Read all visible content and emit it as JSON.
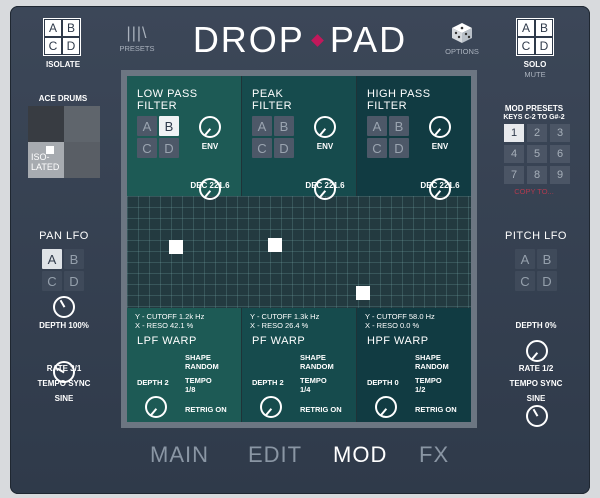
{
  "header": {
    "title_left": "DROP",
    "title_right": "PAD",
    "presets_label": "PRESETS",
    "options_label": "OPTIONS"
  },
  "isolate": {
    "label": "ISOLATE",
    "buttons": [
      "A",
      "B",
      "C",
      "D"
    ]
  },
  "solo": {
    "label": "SOLO",
    "sub": "MUTE",
    "buttons": [
      "A",
      "B",
      "C",
      "D"
    ]
  },
  "kit": {
    "name": "ACE DRUMS",
    "iso_label": "ISO-\nLATED"
  },
  "pan_lfo": {
    "title": "PAN LFO",
    "buttons": [
      "A",
      "B",
      "C",
      "D"
    ],
    "depth": "DEPTH 100%",
    "rate": "RATE 3/1",
    "sync": "TEMPO SYNC",
    "wave": "SINE"
  },
  "pitch_lfo": {
    "title": "PITCH LFO",
    "buttons": [
      "A",
      "B",
      "C",
      "D"
    ],
    "depth": "DEPTH 0%",
    "rate": "RATE 1/2",
    "sync": "TEMPO SYNC",
    "wave": "SINE"
  },
  "mod_presets": {
    "title": "MOD PRESETS",
    "keys": "KEYS C-2 TO G#-2",
    "numbers": [
      "1",
      "2",
      "3",
      "4",
      "5",
      "6",
      "7",
      "8",
      "9"
    ],
    "copy": "COPY TO..."
  },
  "filters": [
    {
      "title1": "LOW PASS",
      "title2": "FILTER",
      "buttons": [
        "A",
        "B",
        "C",
        "D"
      ],
      "env": "ENV",
      "dec": "DEC 221.6",
      "y": "Y - CUTOFF  1.2k Hz",
      "x": "X - RESO 42.1 %",
      "warp": "LPF WARP",
      "depth": "DEPTH 2",
      "shape": "SHAPE",
      "shape_val": "RANDOM",
      "tempo": "TEMPO",
      "tempo_val": "1/8",
      "retrig": "RETRIG ON"
    },
    {
      "title1": "PEAK",
      "title2": "FILTER",
      "buttons": [
        "A",
        "B",
        "C",
        "D"
      ],
      "env": "ENV",
      "dec": "DEC 221.6",
      "y": "Y - CUTOFF  1.3k Hz",
      "x": "X - RESO 26.4 %",
      "warp": "PF WARP",
      "depth": "DEPTH 2",
      "shape": "SHAPE",
      "shape_val": "RANDOM",
      "tempo": "TEMPO",
      "tempo_val": "1/4",
      "retrig": "RETRIG ON"
    },
    {
      "title1": "HIGH PASS",
      "title2": "FILTER",
      "buttons": [
        "A",
        "B",
        "C",
        "D"
      ],
      "env": "ENV",
      "dec": "DEC 221.6",
      "y": "Y - CUTOFF  58.0 Hz",
      "x": "X - RESO 0.0 %",
      "warp": "HPF WARP",
      "depth": "DEPTH 0",
      "shape": "SHAPE",
      "shape_val": "RANDOM",
      "tempo": "TEMPO",
      "tempo_val": "1/2",
      "retrig": "RETRIG ON"
    }
  ],
  "tabs": [
    "MAIN",
    "EDIT",
    "MOD",
    "FX"
  ]
}
